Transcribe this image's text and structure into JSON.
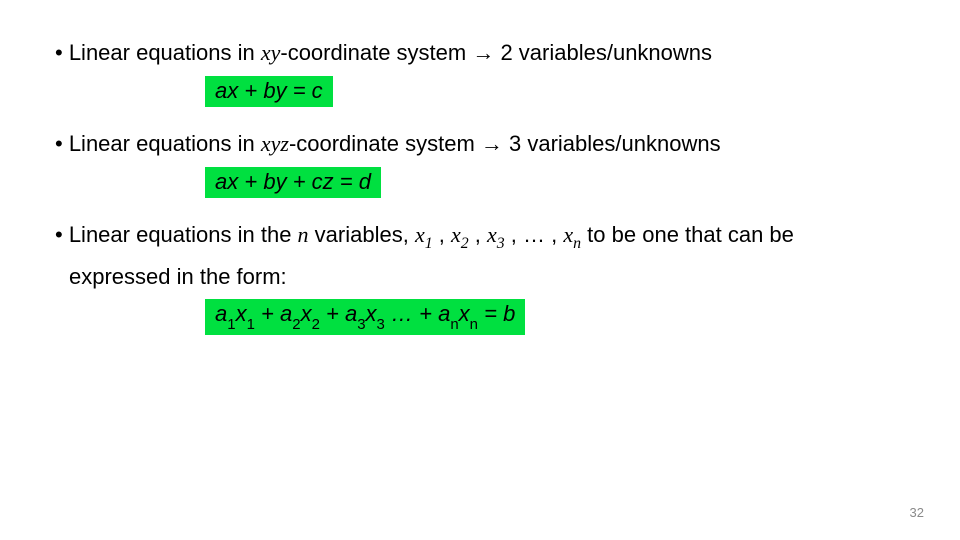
{
  "bullets": {
    "b1_pre": "• Linear equations in ",
    "b1_var": "xy",
    "b1_post": "-coordinate system → 2 variables/unknowns",
    "b2_pre": "• Linear equations in ",
    "b2_var": "xyz",
    "b2_post": "-coordinate system → 3 variables/unknowns",
    "b3_pre": "• Linear equations in the ",
    "b3_n": "n",
    "b3_mid": " variables, ",
    "b3_x": "x",
    "b3_s1": "1",
    "b3_c": " , ",
    "b3_s2": "2",
    "b3_s3": "3",
    "b3_dots": " , … , ",
    "b3_sn": "n",
    "b3_post1": " to be one that can be",
    "b3_post2": "expressed in the form:"
  },
  "equations": {
    "eq1": {
      "a": "a",
      "x": "x",
      "plus": " + ",
      "b": "b",
      "y": "y",
      "eq": " = ",
      "c": "c"
    },
    "eq2": {
      "a": "a",
      "x": "x",
      "plus": " + ",
      "b": "b",
      "y": "y",
      "c": "c",
      "z": "z",
      "eq": " = ",
      "d": "d"
    },
    "eq3": {
      "a": "a",
      "s1": "1",
      "x": "x",
      "plus": " + ",
      "s2": "2",
      "s3": "3",
      "dots": " … ",
      "sn": "n",
      "eq": " = ",
      "b": "b"
    }
  },
  "page": "32"
}
